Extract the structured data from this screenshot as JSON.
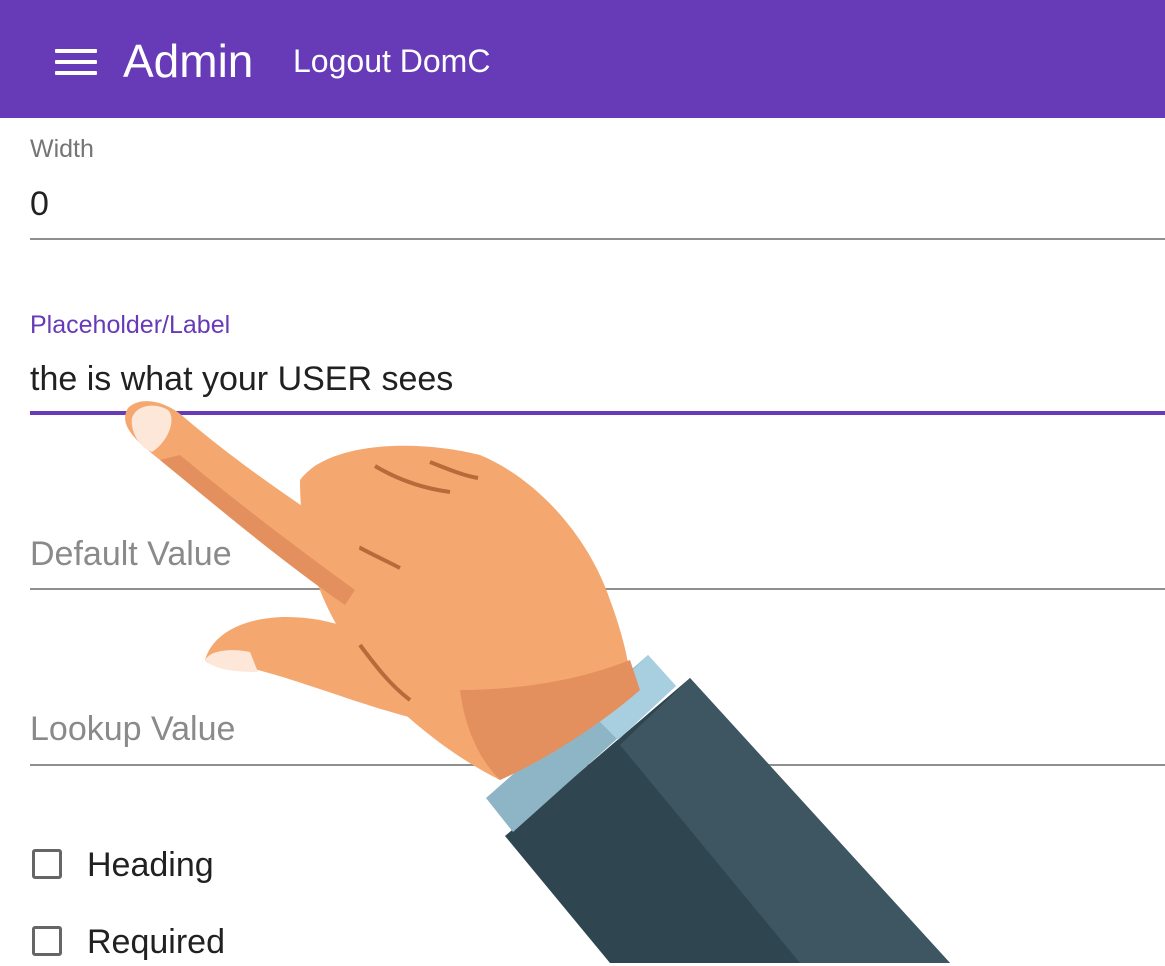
{
  "header": {
    "title": "Admin",
    "logout_label": "Logout DomC",
    "menu_icon": "hamburger-menu-icon",
    "background_color": "#673ab7"
  },
  "form": {
    "width": {
      "label": "Width",
      "value": "0"
    },
    "placeholder_label": {
      "label": "Placeholder/Label",
      "value": "the is what your USER sees",
      "state": "focused"
    },
    "default_value": {
      "placeholder": "Default Value",
      "value": ""
    },
    "lookup_value": {
      "placeholder": "Lookup Value",
      "value": ""
    },
    "checkboxes": [
      {
        "label": "Heading",
        "checked": false
      },
      {
        "label": "Required",
        "checked": false
      }
    ]
  },
  "overlay": {
    "illustration": "pointing-hand-icon"
  }
}
